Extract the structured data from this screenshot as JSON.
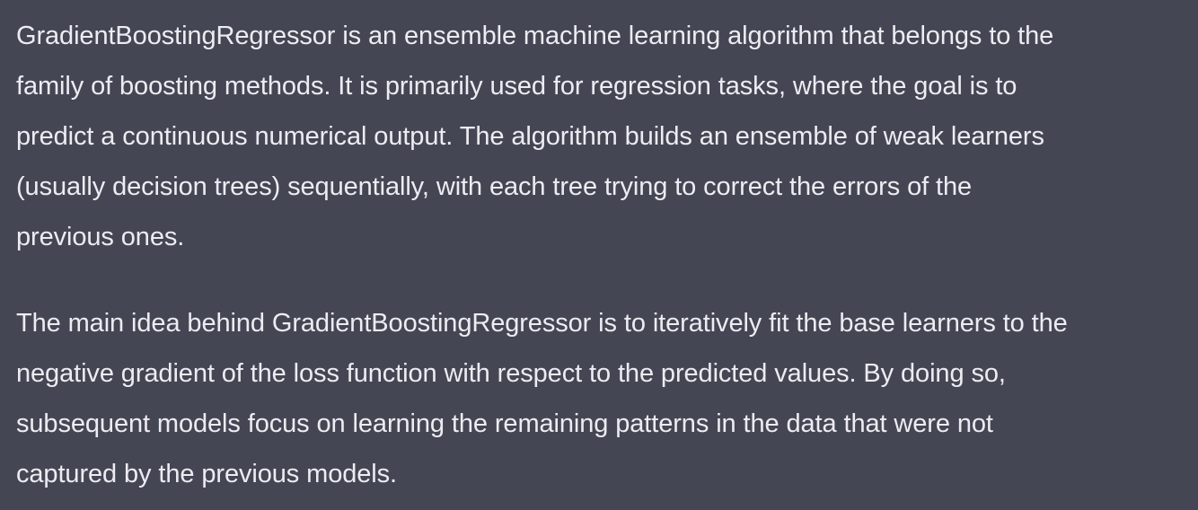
{
  "message": {
    "paragraphs": [
      {
        "lines": [
          "GradientBoostingRegressor is an ensemble machine learning algorithm that belongs to the",
          "family of boosting methods. It is primarily used for regression tasks, where the goal is to",
          "predict a continuous numerical output. The algorithm builds an ensemble of weak learners",
          "(usually decision trees) sequentially, with each tree trying to correct the errors of the",
          "previous ones."
        ]
      },
      {
        "lines": [
          "The main idea behind GradientBoostingRegressor is to iteratively fit the base learners to the",
          "negative gradient of the loss function with respect to the predicted values. By doing so,",
          "subsequent models focus on learning the remaining patterns in the data that were not",
          "captured by the previous models."
        ]
      }
    ]
  },
  "colors": {
    "background": "#444654",
    "text": "#ececf1"
  }
}
